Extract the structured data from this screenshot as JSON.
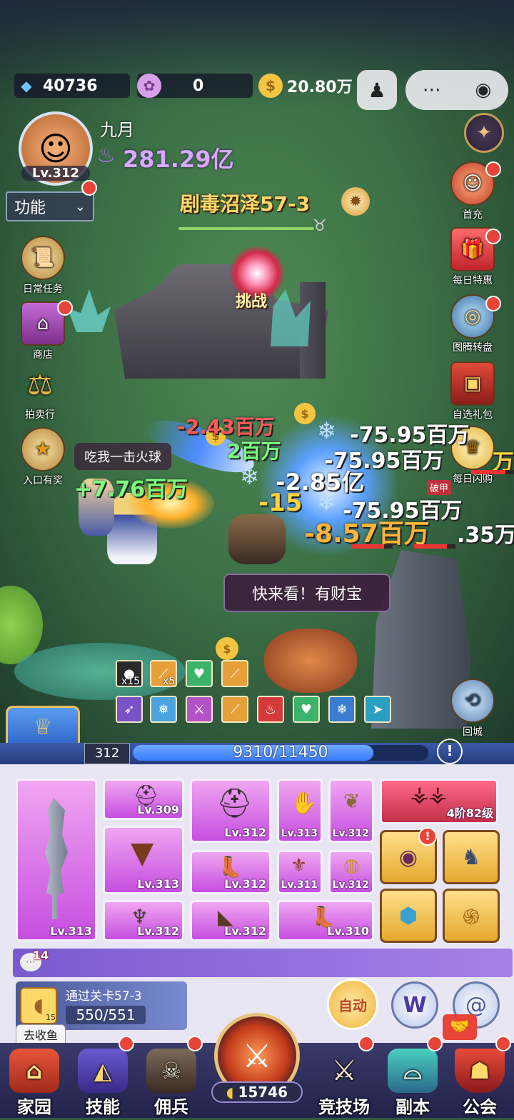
{
  "resources": {
    "diamonds": "40736",
    "scrolls": "0",
    "gold": "20.80万"
  },
  "player": {
    "name": "九月",
    "level": "Lv.312",
    "power": "281.29亿"
  },
  "functions_label": "功能",
  "stage": {
    "name": "剧毒沼泽57-3",
    "challenge": "挑战"
  },
  "left_menu": [
    {
      "label": "日常任务"
    },
    {
      "label": "商店"
    },
    {
      "label": "拍卖行"
    },
    {
      "label": "入口有奖"
    }
  ],
  "right_menu": [
    {
      "label": "首充"
    },
    {
      "label": "每日特惠"
    },
    {
      "label": "图腾转盘"
    },
    {
      "label": "自选礼包"
    },
    {
      "label": "每日闪购"
    },
    {
      "label": "回城"
    }
  ],
  "battle": {
    "speech_fireball": "吃我一击火球",
    "speech_treasure": "快来看！有财宝",
    "armor_break": "破甲",
    "damage": [
      "-2.43百万",
      "2百万",
      "-75.95百万",
      "-75.95百万",
      "-2.85亿",
      "-15",
      "-75.95百万",
      "-8.57百万",
      "+7.76百万",
      ".35万",
      "万"
    ],
    "skill_counts": [
      "x15",
      "x5"
    ]
  },
  "exp_bar": {
    "level": "312",
    "current": 9310,
    "max": 11450,
    "text": "9310/11450",
    "progress": 0.813
  },
  "equipment": {
    "weapon_level": "Lv.313",
    "slots": [
      "Lv.309",
      "Lv.312",
      "Lv.313",
      "Lv.312",
      "Lv.313",
      "Lv.312",
      "Lv.311",
      "Lv.312",
      "Lv.312",
      "Lv.312",
      "Lv.310"
    ],
    "wings": "4阶82级"
  },
  "chat": {
    "badge": "14"
  },
  "quest": {
    "title": "通过关卡57-3",
    "progress": "550/551",
    "item_count": "15"
  },
  "actions": {
    "auto": "自动",
    "go_fishing": "去收鱼"
  },
  "nav": {
    "home": "家园",
    "skills": "技能",
    "mercenary": "佣兵",
    "battle_count": "15746",
    "arena": "竞技场",
    "dungeon": "副本",
    "guild": "公会"
  },
  "colors": {
    "accent_purple": "#c64ee0",
    "gold": "#f5c542",
    "bar_blue": "#3a7cff"
  }
}
